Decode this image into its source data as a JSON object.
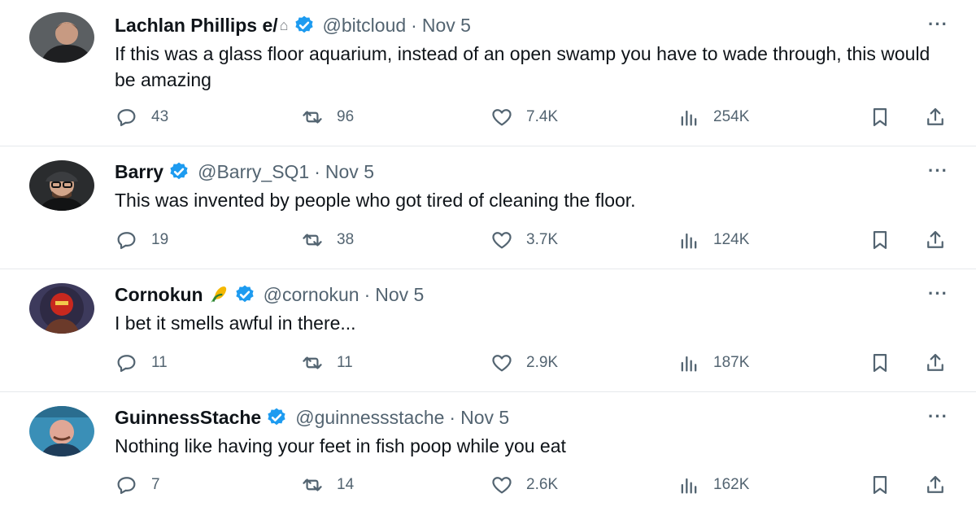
{
  "tweets": [
    {
      "name": "Lachlan Phillips e/",
      "name_extra": "⌂",
      "handle": "@bitcloud",
      "separator": "·",
      "date": "Nov 5",
      "text": "If this was a glass floor aquarium, instead of an open swamp you have to wade through, this would be amazing",
      "replies": "43",
      "reposts": "96",
      "likes": "7.4K",
      "views": "254K",
      "more": "···"
    },
    {
      "name": "Barry",
      "handle": "@Barry_SQ1",
      "separator": "·",
      "date": "Nov 5",
      "text": "This was invented by people who got tired of cleaning the floor.",
      "replies": "19",
      "reposts": "38",
      "likes": "3.7K",
      "views": "124K",
      "more": "···"
    },
    {
      "name": "Cornokun",
      "emoji": "corn-icon",
      "handle": "@cornokun",
      "separator": "·",
      "date": "Nov 5",
      "text": "I bet it smells awful in there...",
      "replies": "11",
      "reposts": "11",
      "likes": "2.9K",
      "views": "187K",
      "more": "···"
    },
    {
      "name": "GuinnessStache",
      "handle": "@guinnessstache",
      "separator": "·",
      "date": "Nov 5",
      "text": "Nothing like having your feet in fish poop while you eat",
      "replies": "7",
      "reposts": "14",
      "likes": "2.6K",
      "views": "162K",
      "more": "···"
    }
  ],
  "colors": {
    "text": "#0f1419",
    "secondary": "#536471",
    "verified": "#1d9bf0",
    "divider": "#e6e9ec"
  }
}
